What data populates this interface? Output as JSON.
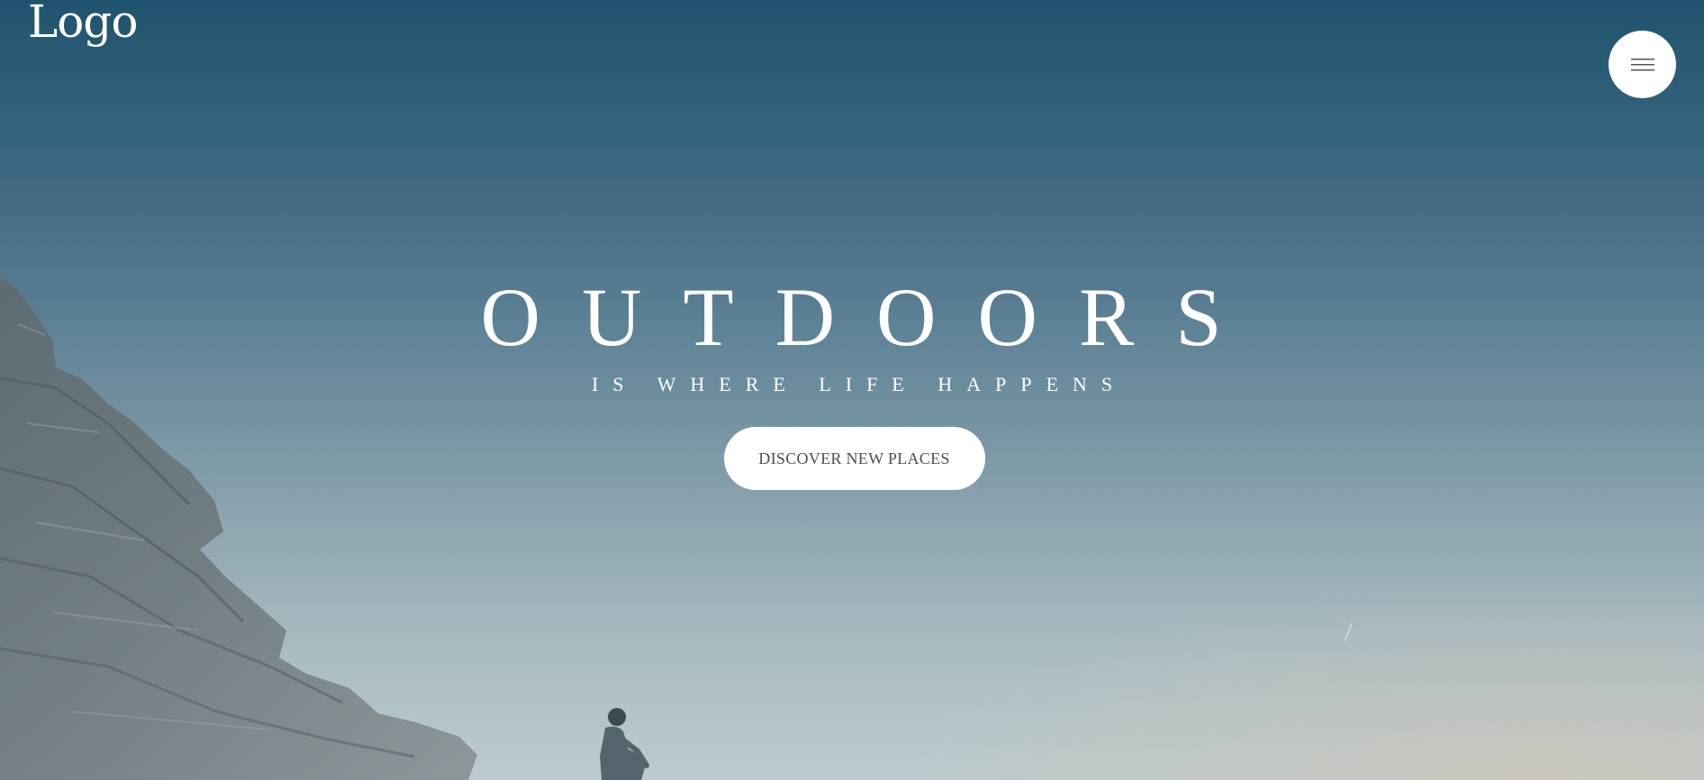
{
  "header": {
    "logo_text": "Logo",
    "menu_icon": "hamburger-menu-icon"
  },
  "hero": {
    "title": "OUTDOORS",
    "subtitle": "IS WHERE LIFE HAPPENS",
    "cta_label": "DISCOVER NEW PLACES"
  },
  "colors": {
    "sky_top": "#1f536d",
    "sky_bottom": "#bccbcd",
    "text": "#ffffff",
    "button_bg": "#ffffff",
    "button_text": "#4b4f52"
  }
}
